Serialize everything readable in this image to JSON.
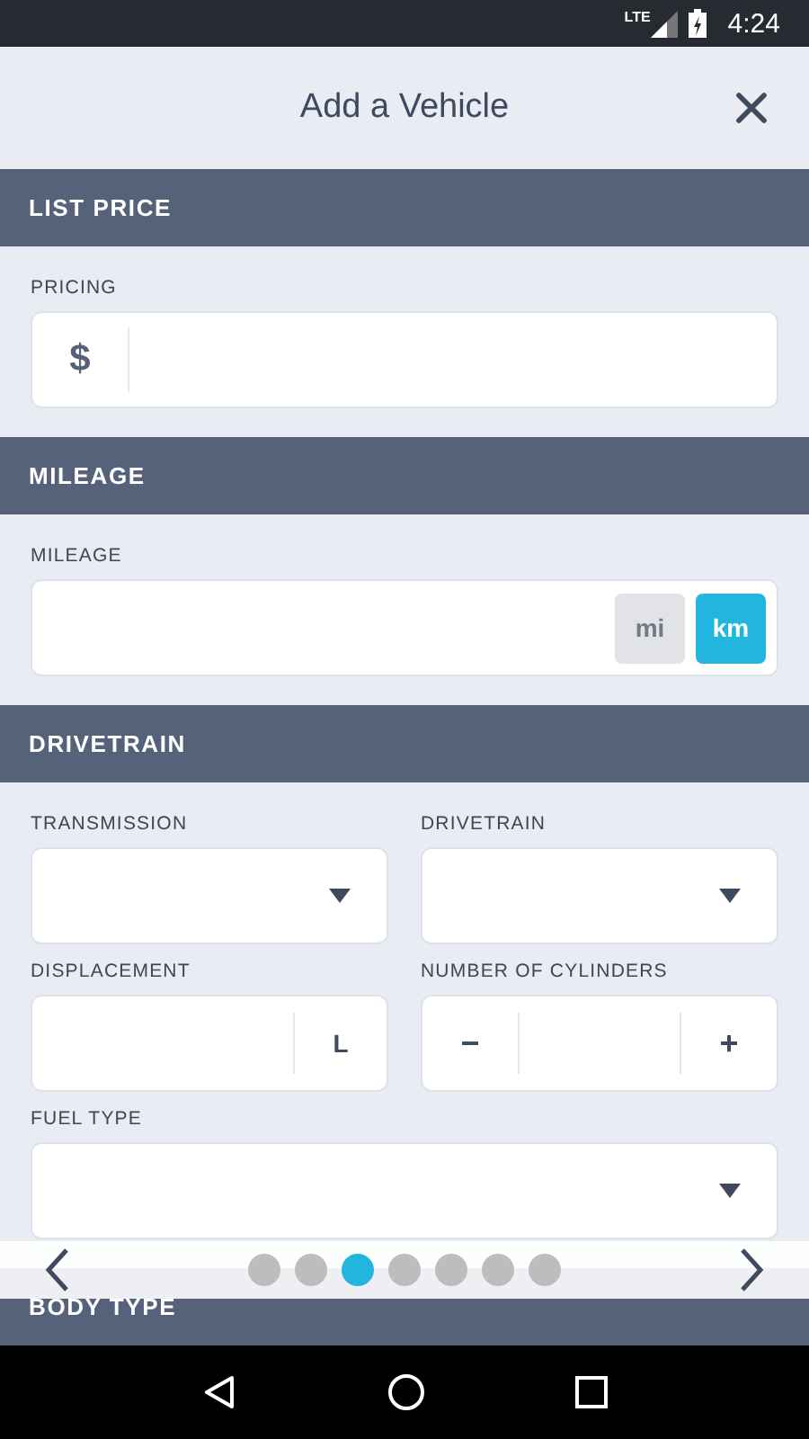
{
  "status_bar": {
    "network": "LTE",
    "time": "4:24"
  },
  "header": {
    "title": "Add a Vehicle"
  },
  "sections": [
    {
      "title": "LIST PRICE",
      "fields": [
        {
          "kind": "currency",
          "label": "PRICING",
          "symbol": "$",
          "wide": true
        }
      ]
    },
    {
      "title": "MILEAGE",
      "fields": [
        {
          "kind": "units",
          "label": "MILEAGE",
          "wide": true,
          "units": [
            {
              "label": "mi",
              "selected": false
            },
            {
              "label": "km",
              "selected": true
            }
          ]
        }
      ]
    },
    {
      "title": "DRIVETRAIN",
      "fields": [
        {
          "kind": "select",
          "label": "TRANSMISSION",
          "wide": false
        },
        {
          "kind": "select",
          "label": "DRIVETRAIN",
          "wide": false
        },
        {
          "kind": "suffix",
          "label": "DISPLACEMENT",
          "suffix": "L",
          "wide": false
        },
        {
          "kind": "stepper",
          "label": "NUMBER OF CYLINDERS",
          "minus": "−",
          "plus": "+",
          "wide": false
        },
        {
          "kind": "select",
          "label": "FUEL TYPE",
          "wide": true
        }
      ]
    },
    {
      "title": "BODY TYPE"
    }
  ],
  "pager": {
    "pages": [
      {
        "selected": false
      },
      {
        "selected": false
      },
      {
        "selected": true
      },
      {
        "selected": false
      },
      {
        "selected": false
      },
      {
        "selected": false
      },
      {
        "selected": false
      }
    ]
  }
}
